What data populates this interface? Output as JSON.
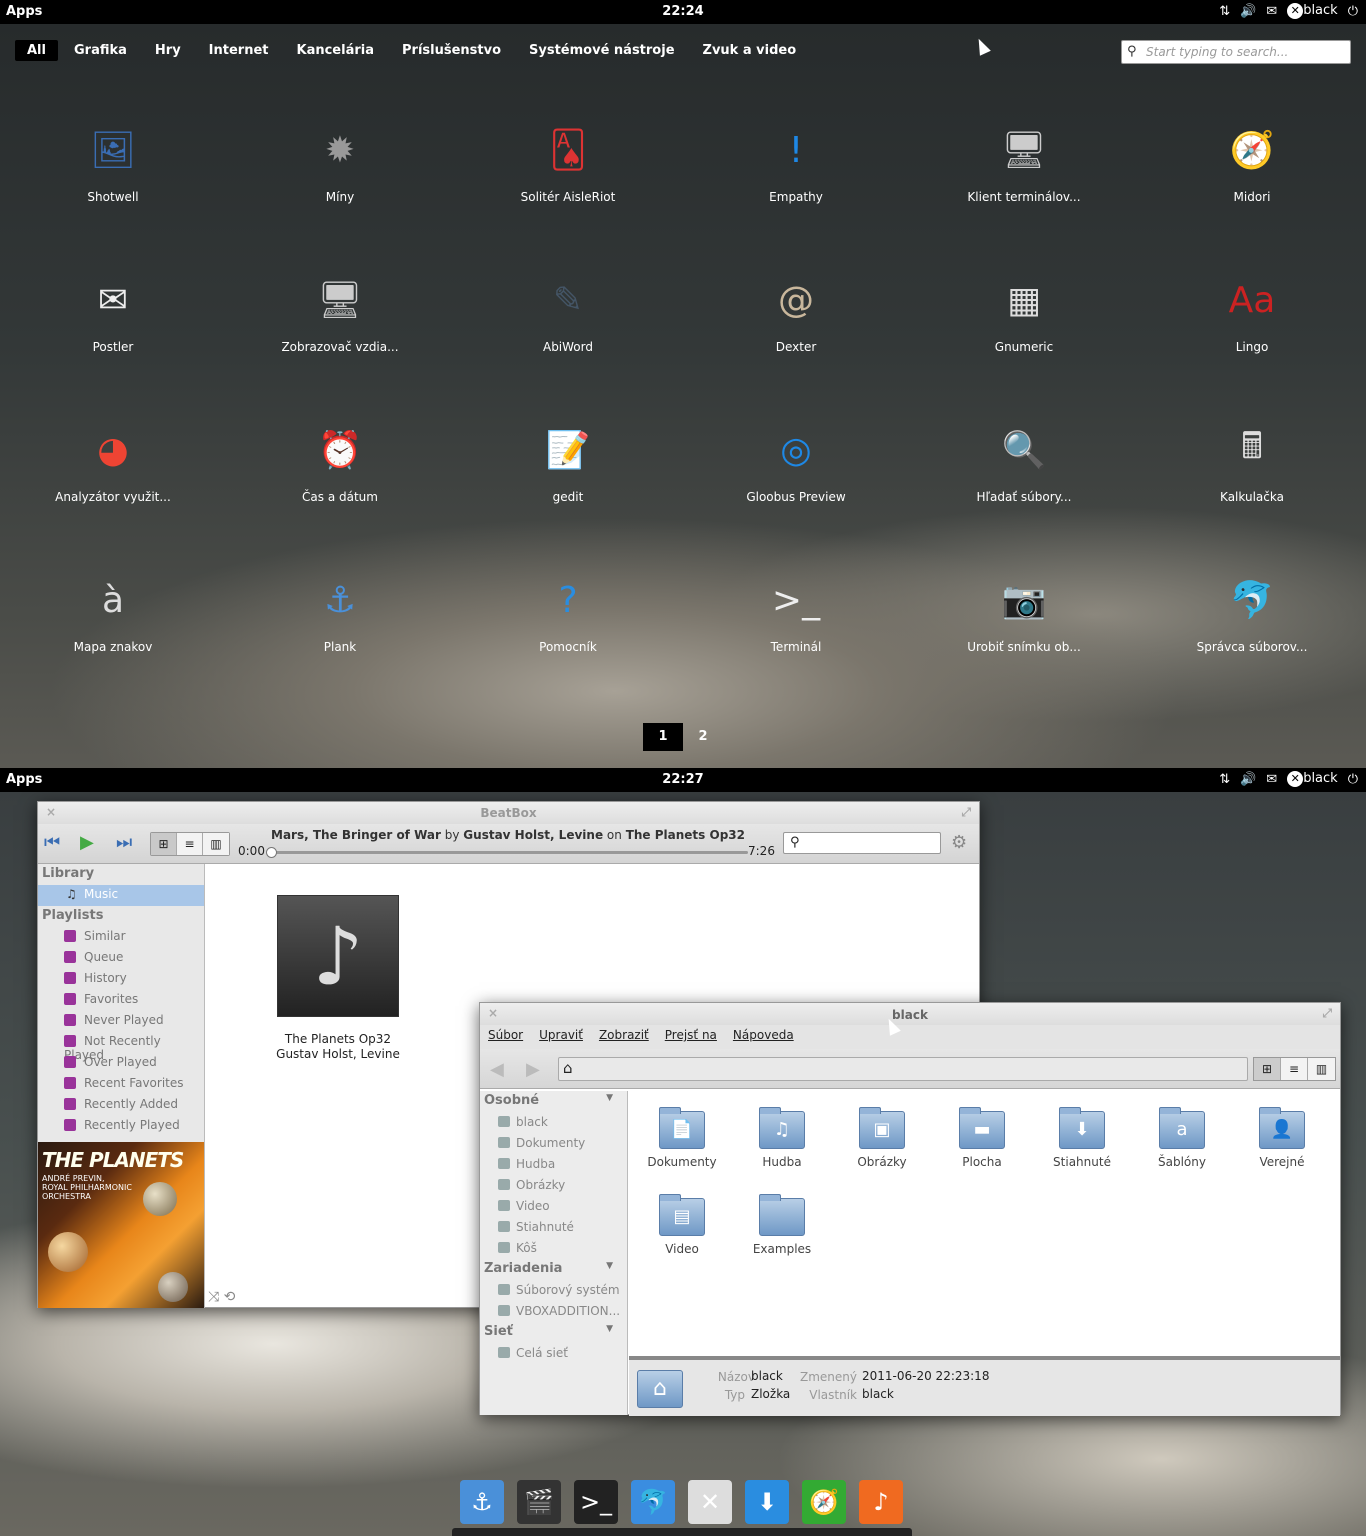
{
  "screen1": {
    "panel": {
      "apps": "Apps",
      "clock": "22:24",
      "user": "black"
    },
    "categories": [
      "All",
      "Grafika",
      "Hry",
      "Internet",
      "Kancelária",
      "Príslušenstvo",
      "Systémové nástroje",
      "Zvuk a video"
    ],
    "search_placeholder": "Start typing to search...",
    "apps": [
      {
        "label": "Shotwell",
        "icon": "photo-icon",
        "glyph": "🖼",
        "color": "#3a6db3"
      },
      {
        "label": "Míny",
        "icon": "mine-icon",
        "glyph": "✹",
        "color": "#999"
      },
      {
        "label": "Solitér AisleRiot",
        "icon": "cards-icon",
        "glyph": "🂡",
        "color": "#d33"
      },
      {
        "label": "Empathy",
        "icon": "chat-bubble-icon",
        "glyph": "!",
        "color": "#1e88e5"
      },
      {
        "label": "Klient terminálov...",
        "icon": "remote-desktop-icon",
        "glyph": "🖥",
        "color": "#ccc"
      },
      {
        "label": "Midori",
        "icon": "compass-icon",
        "glyph": "🧭",
        "color": "#3a3"
      },
      {
        "label": "Postler",
        "icon": "envelope-icon",
        "glyph": "✉",
        "color": "#eee"
      },
      {
        "label": "Zobrazovač vzdia...",
        "icon": "remote-viewer-icon",
        "glyph": "🖥",
        "color": "#ccc"
      },
      {
        "label": "AbiWord",
        "icon": "document-pen-icon",
        "glyph": "✎",
        "color": "#456"
      },
      {
        "label": "Dexter",
        "icon": "address-book-icon",
        "glyph": "@",
        "color": "#c9b79c"
      },
      {
        "label": "Gnumeric",
        "icon": "spreadsheet-icon",
        "glyph": "▦",
        "color": "#ddd"
      },
      {
        "label": "Lingo",
        "icon": "dictionary-icon",
        "glyph": "Aa",
        "color": "#c22"
      },
      {
        "label": "Analyzátor využit...",
        "icon": "pie-chart-icon",
        "glyph": "◕",
        "color": "#e43"
      },
      {
        "label": "Čas a dátum",
        "icon": "calendar-clock-icon",
        "glyph": "⏰",
        "color": "#eee"
      },
      {
        "label": "gedit",
        "icon": "text-editor-icon",
        "glyph": "📝",
        "color": "#eee"
      },
      {
        "label": "Gloobus Preview",
        "icon": "gloobus-icon",
        "glyph": "◎",
        "color": "#1e88e5"
      },
      {
        "label": "Hľadať súbory...",
        "icon": "magnifier-icon",
        "glyph": "🔍",
        "color": "#ccc"
      },
      {
        "label": "Kalkulačka",
        "icon": "calculator-icon",
        "glyph": "🖩",
        "color": "#ddd"
      },
      {
        "label": "Mapa znakov",
        "icon": "character-map-icon",
        "glyph": "à",
        "color": "#ddd"
      },
      {
        "label": "Plank",
        "icon": "anchor-icon",
        "glyph": "⚓",
        "color": "#4a90d9"
      },
      {
        "label": "Pomocník",
        "icon": "help-icon",
        "glyph": "?",
        "color": "#2a8de0"
      },
      {
        "label": "Terminál",
        "icon": "terminal-icon",
        "glyph": ">_",
        "color": "#eee"
      },
      {
        "label": "Urobiť snímku ob...",
        "icon": "camera-icon",
        "glyph": "📷",
        "color": "#ccc"
      },
      {
        "label": "Správca súborov...",
        "icon": "file-manager-icon",
        "glyph": "🐬",
        "color": "#3a8de0"
      }
    ],
    "pages": [
      "1",
      "2"
    ]
  },
  "screen2": {
    "panel": {
      "apps": "Apps",
      "clock": "22:27",
      "user": "black"
    },
    "beatbox": {
      "title": "BeatBox",
      "track": "Mars, The Bringer of War",
      "by": "by",
      "artist": "Gustav Holst, Levine",
      "on": "on",
      "album": "The Planets Op32",
      "elapsed": "0:00",
      "duration": "7:26",
      "progress_fraction": 0,
      "sidebar": {
        "library_header": "Library",
        "music": "Music",
        "playlists_header": "Playlists",
        "playlists": [
          "Similar",
          "Queue",
          "History",
          "Favorites",
          "Never Played",
          "Not Recently Played",
          "Over Played",
          "Recent Favorites",
          "Recently Added",
          "Recently Played"
        ]
      },
      "cover_art": {
        "title": "THE PLANETS",
        "credits": "ANDRÉ PREVIN, ROYAL PHILHARMONIC ORCHESTRA"
      },
      "album_item": {
        "title": "The Planets Op32",
        "artist": "Gustav Holst, Levine"
      }
    },
    "filemanager": {
      "title": "black",
      "menu": [
        "Súbor",
        "Upraviť",
        "Zobraziť",
        "Prejsť na",
        "Nápoveda"
      ],
      "sidebar": {
        "personal_header": "Osobné",
        "personal": [
          "black",
          "Dokumenty",
          "Hudba",
          "Obrázky",
          "Video",
          "Stiahnuté",
          "Kôš"
        ],
        "devices_header": "Zariadenia",
        "devices": [
          "Súborový systém",
          "VBOXADDITION..."
        ],
        "network_header": "Sieť",
        "network": [
          "Celá sieť"
        ]
      },
      "folders": [
        {
          "name": "Dokumenty",
          "glyph": "📄"
        },
        {
          "name": "Hudba",
          "glyph": "♫"
        },
        {
          "name": "Obrázky",
          "glyph": "▣"
        },
        {
          "name": "Plocha",
          "glyph": "▬"
        },
        {
          "name": "Stiahnuté",
          "glyph": "⬇"
        },
        {
          "name": "Šablóny",
          "glyph": "a"
        },
        {
          "name": "Verejné",
          "glyph": "👤"
        },
        {
          "name": "Video",
          "glyph": "▤"
        },
        {
          "name": "Examples",
          "glyph": ""
        }
      ],
      "info": {
        "name_label": "Názov",
        "name": "black",
        "type_label": "Typ",
        "type": "Zložka",
        "modified_label": "Zmenený",
        "modified": "2011-06-20 22:23:18",
        "owner_label": "Vlastník",
        "owner": "black"
      }
    },
    "dock": [
      {
        "icon": "anchor-icon",
        "glyph": "⚓",
        "color": "#4a90d9"
      },
      {
        "icon": "clapperboard-icon",
        "glyph": "🎬",
        "color": "#333"
      },
      {
        "icon": "terminal-icon",
        "glyph": ">_",
        "color": "#222"
      },
      {
        "icon": "file-manager-icon",
        "glyph": "🐬",
        "color": "#3a8de0"
      },
      {
        "icon": "settings-tools-icon",
        "glyph": "✕",
        "color": "#ddd"
      },
      {
        "icon": "download-icon",
        "glyph": "⬇",
        "color": "#2a8de0"
      },
      {
        "icon": "compass-icon",
        "glyph": "🧭",
        "color": "#3a3"
      },
      {
        "icon": "music-note-icon",
        "glyph": "♪",
        "color": "#f06a20"
      }
    ]
  }
}
